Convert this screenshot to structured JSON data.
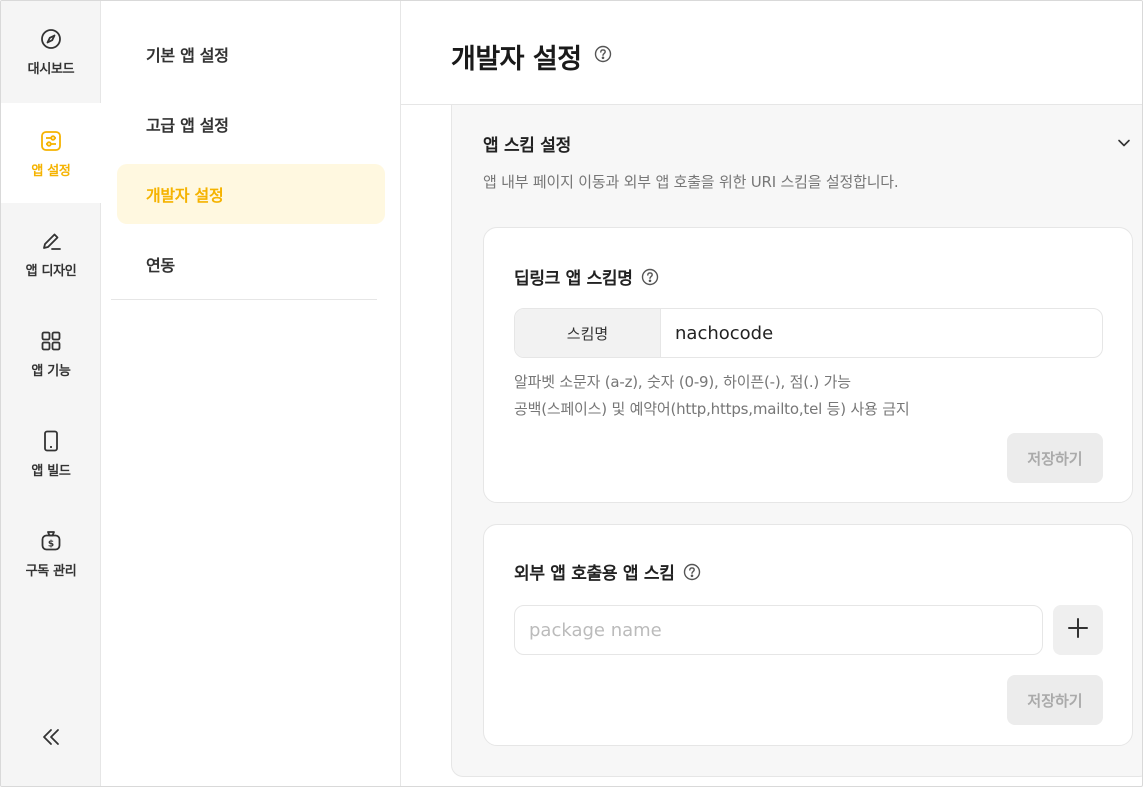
{
  "rail": {
    "items": [
      {
        "label": "대시보드",
        "icon": "compass-icon",
        "active": false
      },
      {
        "label": "앱 설정",
        "icon": "sliders-icon",
        "active": true
      },
      {
        "label": "앱 디자인",
        "icon": "pen-icon",
        "active": false
      },
      {
        "label": "앱 기능",
        "icon": "grid-icon",
        "active": false
      },
      {
        "label": "앱 빌드",
        "icon": "phone-icon",
        "active": false
      },
      {
        "label": "구독 관리",
        "icon": "money-bag-icon",
        "active": false
      }
    ],
    "collapse_icon": "double-chevron-left-icon"
  },
  "subnav": {
    "items": [
      {
        "label": "기본 앱 설정",
        "active": false
      },
      {
        "label": "고급 앱 설정",
        "active": false
      },
      {
        "label": "개발자 설정",
        "active": true
      },
      {
        "label": "연동",
        "active": false
      }
    ]
  },
  "header": {
    "title": "개발자 설정"
  },
  "section": {
    "title": "앱 스킴 설정",
    "description": "앱 내부 페이지 이동과 외부 앱 호출을 위한 URI 스킴을 설정합니다."
  },
  "deeplink_card": {
    "title": "딥링크 앱 스킴명",
    "field_label": "스킴명",
    "field_value": "nachocode",
    "hint_line1": "알파벳 소문자 (a-z), 숫자 (0-9), 하이픈(-), 점(.) 가능",
    "hint_line2": "공백(스페이스) 및 예약어(http,https,mailto,tel 등) 사용 금지",
    "save_label": "저장하기"
  },
  "external_card": {
    "title": "외부 앱 호출용 앱 스킴",
    "input_placeholder": "package name",
    "add_icon": "plus-icon",
    "save_label": "저장하기"
  },
  "colors": {
    "accent": "#f5b301",
    "accent_bg": "#fff8e0"
  }
}
